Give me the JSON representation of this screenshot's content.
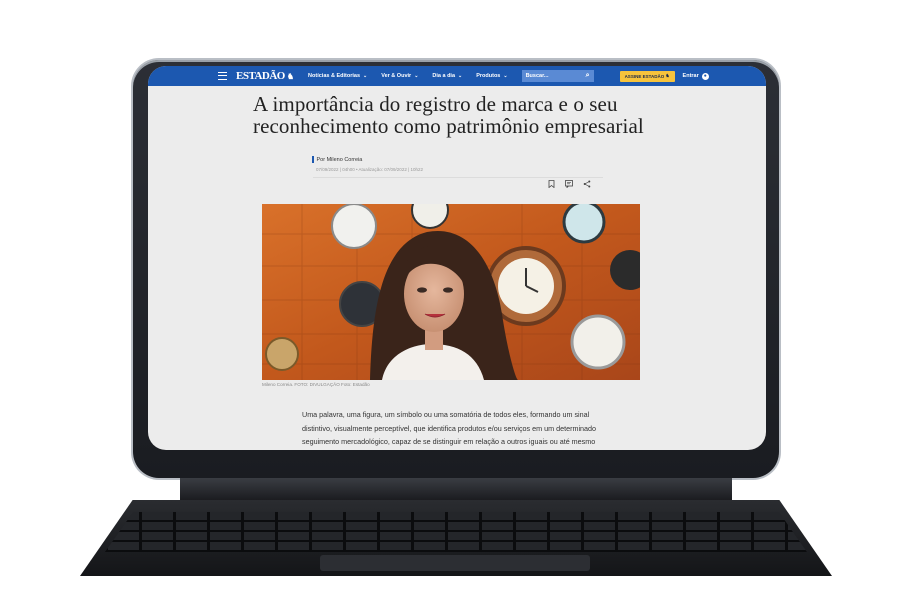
{
  "nav": {
    "logo": "ESTADÃO",
    "logo_mark": "♞",
    "items": [
      {
        "label": "Notícias & Editorias"
      },
      {
        "label": "Ver & Ouvir"
      },
      {
        "label": "Dia a dia"
      },
      {
        "label": "Produtos"
      }
    ],
    "search_placeholder": "Buscar...",
    "subscribe_label": "ASSINE ESTADÃO",
    "login_label": "Entrar"
  },
  "article": {
    "headline": "A importância do registro de marca e o seu reconhecimento como patrimônio empresarial",
    "byline": "Por Mileno Correia",
    "dates": "07/09/2022 | 04h00   •   Atualização: 07/09/2022 | 10h22",
    "caption": "Mileno Correia. FOTO: DIVULGAÇÃO Foto: Estadão",
    "body": "Uma palavra, uma figura, um símbolo ou uma somatória de todos eles, formando um sinal distintivo, visualmente perceptível, que identifica produtos e/ou serviços em um determinado seguimento mercadológico, capaz de se distinguir em relação a outros iguais ou até mesmo semelhantes perante seu consumidor, este é a definição"
  },
  "colors": {
    "nav_blue": "#1c58b0",
    "subscribe_yellow": "#f6c33c",
    "device_frame": "#1a1c21"
  },
  "icons": [
    "menu-icon",
    "search-icon",
    "user-icon",
    "bookmark-icon",
    "comment-icon",
    "share-icon",
    "chevron-down-icon"
  ]
}
